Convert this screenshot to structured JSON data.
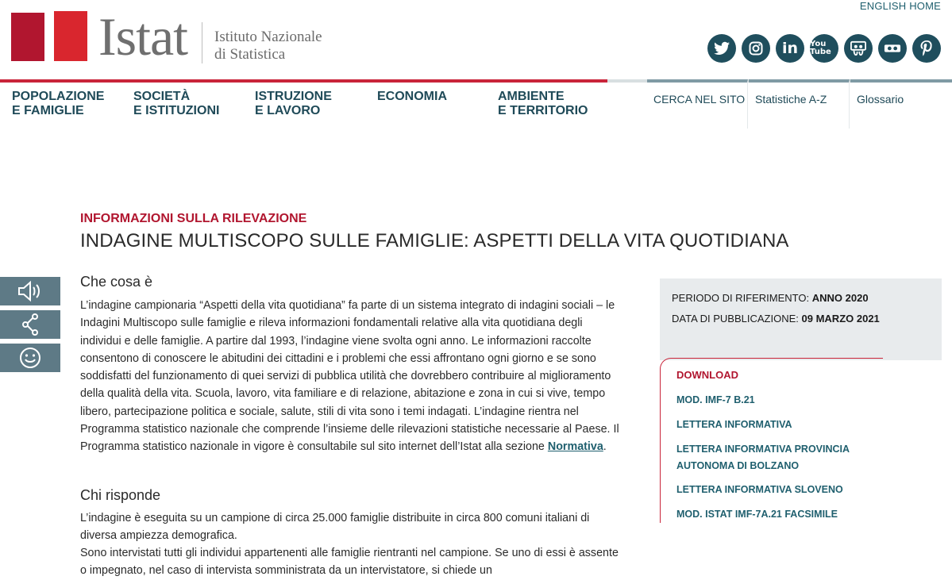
{
  "header": {
    "english_home": "ENGLISH HOME",
    "brand": "Istat",
    "institute_line1": "Istituto Nazionale",
    "institute_line2": "di Statistica",
    "colors": {
      "brand_dark_red": "#b1162f",
      "brand_red": "#d9262e",
      "teal": "#1f4e5d"
    }
  },
  "social": [
    {
      "name": "twitter-icon",
      "label": ""
    },
    {
      "name": "instagram-icon",
      "label": ""
    },
    {
      "name": "linkedin-icon",
      "label": "in"
    },
    {
      "name": "youtube-icon",
      "label": "You Tube"
    },
    {
      "name": "slideshare-icon",
      "label": ""
    },
    {
      "name": "flickr-icon",
      "label": ""
    },
    {
      "name": "pinterest-icon",
      "label": ""
    }
  ],
  "nav": {
    "main": [
      {
        "line1": "POPOLAZIONE",
        "line2": "E FAMIGLIE"
      },
      {
        "line1": "SOCIETÀ",
        "line2": "E ISTITUZIONI"
      },
      {
        "line1": "ISTRUZIONE",
        "line2": "E LAVORO"
      },
      {
        "line1": "ECONOMIA",
        "line2": ""
      },
      {
        "line1": "AMBIENTE",
        "line2": "E TERRITORIO"
      }
    ],
    "utility": [
      {
        "label": "CERCA NEL SITO"
      },
      {
        "label": "Statistiche A-Z"
      },
      {
        "label": "Glossario"
      }
    ]
  },
  "sidetools": [
    {
      "name": "audio-icon"
    },
    {
      "name": "share-icon"
    },
    {
      "name": "smiley-icon"
    }
  ],
  "main": {
    "kicker": "INFORMAZIONI SULLA RILEVAZIONE",
    "title": "INDAGINE MULTISCOPO SULLE FAMIGLIE: ASPETTI DELLA VITA QUOTIDIANA",
    "section1_heading": "Che cosa è",
    "section1_text": "L’indagine campionaria “Aspetti della vita quotidiana” fa parte di un sistema integrato di indagini sociali – le Indagini Multiscopo sulle famiglie e rileva informazioni fondamentali relative alla vita quotidiana degli individui e delle famiglie. A partire dal 1993, l’indagine viene svolta ogni anno. Le informazioni raccolte consentono di conoscere le abitudini dei cittadini e i problemi che essi affrontano ogni giorno e se sono soddisfatti del funzionamento di quei servizi di pubblica utilità che dovrebbero contribuire al miglioramento della qualità della vita. Scuola, lavoro, vita familiare e di relazione, abitazione e zona in cui si vive, tempo libero, partecipazione politica e sociale, salute, stili di vita sono i temi indagati. L’indagine rientra nel Programma statistico nazionale che comprende l’insieme delle rilevazioni statistiche necessarie al Paese. Il Programma statistico nazionale in vigore è consultabile sul sito internet dell’Istat alla sezione ",
    "section1_link": "Normativa",
    "section1_end": ".",
    "section2_heading": "Chi risponde",
    "section2_text1": "L’indagine è eseguita su un campione di circa 25.000 famiglie distribuite in circa 800 comuni italiani di diversa ampiezza demografica.",
    "section2_text2": "Sono intervistati tutti gli individui appartenenti alle famiglie rientranti nel campione. Se uno di essi è assente o impegnato, nel caso di intervista somministrata da un intervistatore, si chiede un"
  },
  "info": {
    "period_label": "PERIODO DI RIFERIMENTO:",
    "period_value": "ANNO 2020",
    "pub_label": "DATA DI PUBBLICAZIONE:",
    "pub_value": "09 MARZO 2021"
  },
  "download": {
    "heading": "DOWNLOAD",
    "items": [
      "MOD. IMF-7 B.21",
      "LETTERA INFORMATIVA",
      "LETTERA INFORMATIVA PROVINCIA AUTONOMA DI BOLZANO",
      "LETTERA INFORMATIVA SLOVENO",
      "MOD. ISTAT IMF-7A.21 FACSIMILE"
    ]
  }
}
